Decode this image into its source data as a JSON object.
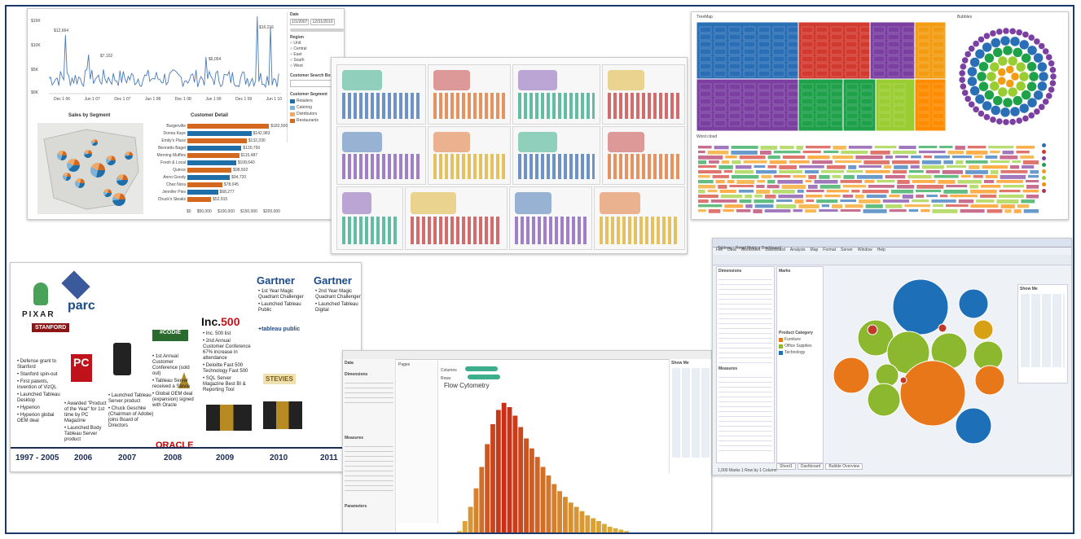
{
  "panel_sales": {
    "y_ticks": [
      "$15K",
      "$10K",
      "$5K",
      "$0K"
    ],
    "peak_labels": [
      "$12,664",
      "$7,152",
      "$6,054",
      "$16,216"
    ],
    "x_ticks": [
      "Dec 1 06",
      "Jun 1 07",
      "Dec 1 07",
      "Jun 1 08",
      "Dec 1 08",
      "Jun 1 09",
      "Dec 1 09",
      "Jun 1 10",
      "Dec 1 10"
    ],
    "filter": {
      "date_label": "Date",
      "date_from": "1/1/2007",
      "date_to": "12/31/2010",
      "region_label": "Region",
      "regions": [
        "Unit",
        "Central",
        "East",
        "South",
        "West"
      ],
      "search_label": "Customer Search Box",
      "segment_label": "Customer Segment",
      "segments": [
        "Retailers",
        "Catering",
        "Distributors",
        "Restaurants"
      ],
      "segment_colors": [
        "#1f6ea8",
        "#7fb2d8",
        "#f0a868",
        "#d2691e"
      ]
    },
    "map_title": "Sales by Segment",
    "detail_title": "Customer Detail",
    "customers": [
      "Burgerville",
      "Donna Kaye",
      "Emily's Place",
      "Bennetts Bagel",
      "Morning Muffins",
      "Fresh & Local",
      "Quince",
      "Anno Goody",
      "Chez Nora",
      "Jennifer Pies",
      "Chuck's Steaks"
    ],
    "customer_values": [
      "$182,500",
      "$142,983",
      "$132,330",
      "$120,750",
      "$115,487",
      "$108,640",
      "$98,502",
      "$94,720",
      "$78,045",
      "$68,277",
      "$52,915"
    ],
    "detail_axis": [
      "$0",
      "$50,000",
      "$100,000",
      "$150,000",
      "$200,000"
    ]
  },
  "timeline": {
    "logos": {
      "pixar": "PIXAR",
      "parc": "parc",
      "stanford": "STANFORD",
      "pc_mag": "PC",
      "oracle": "ORACLE",
      "inc": "Inc.",
      "inc_num": "500",
      "gartner1": "Gartner",
      "gartner2": "Gartner",
      "tableau_public": "+tableau public",
      "stevies": "STEVIES",
      "codie": "#CODiE"
    },
    "col_1997": [
      "Defense grant to Stanford",
      "Stanford spin-out",
      "First patents, invention of VizQL",
      "Launched Tableau Desktop",
      "Hyperion",
      "Hyperion global OEM deal"
    ],
    "col_2006": [
      "Awarded \"Product of the Year\" for 1st time by PC Magazine",
      "Launched Body Tableau Server product"
    ],
    "col_2007": [
      "Launched Tableau Server product",
      "Chuck Geschke (Chairman of Adobe) joins Board of Directors"
    ],
    "col_2008": [
      "1st Annual Customer Conference (sold out)",
      "Tableau Server received a Stevie",
      "Global OEM deal (expansion) signed with Oracle"
    ],
    "col_2009": [
      "Inc. 500 list",
      "2nd Annual Customer Conference 67% increase in attendance",
      "Deloitte Fast 500 Technology Fast 500",
      "SQL Server Magazine Best BI & Reporting Tool"
    ],
    "col_2010": [
      "1st Year Magic Quadrant Challenger",
      "Launched Tableau Public"
    ],
    "col_2011": [
      "2nd Year Magic Quadrant Challenger",
      "Launched Tableau Digital"
    ],
    "years": [
      "1997 - 2005",
      "2006",
      "2007",
      "2008",
      "2009",
      "2010",
      "2011"
    ]
  },
  "panel_treemap": {
    "treemap_title": "TreeMap",
    "bubble_title": "Bubbles",
    "word_title": "Word cloud",
    "colors": [
      "#2a6fb5",
      "#d23a2f",
      "#7a3fa0",
      "#1fa14a",
      "#f39c12",
      "#9acd32",
      "#ff8c00",
      "#b03060"
    ]
  },
  "panel_flow": {
    "title": "Flow Cytometry",
    "shelf_columns": "Columns",
    "shelf_rows": "Rows",
    "shelf_pages": "Pages",
    "side_data": "Data",
    "side_dimensions": "Dimensions",
    "side_measures": "Measures",
    "side_parameters": "Parameters",
    "show_me": "Show Me",
    "bar_heights": [
      0.05,
      0.12,
      0.22,
      0.35,
      0.5,
      0.66,
      0.8,
      0.9,
      0.95,
      0.92,
      0.86,
      0.78,
      0.7,
      0.63,
      0.57,
      0.5,
      0.44,
      0.38,
      0.33,
      0.29,
      0.25,
      0.22,
      0.19,
      0.16,
      0.14,
      0.12,
      0.1,
      0.08,
      0.07,
      0.06,
      0.05,
      0.04,
      0.035,
      0.03,
      0.025,
      0.02,
      0.015,
      0.01
    ]
  },
  "panel_bubble": {
    "window_title": "Tableau - Retail Metrics Dashboard",
    "menu": [
      "File",
      "Data",
      "Worksheet",
      "Dashboard",
      "Analysis",
      "Map",
      "Format",
      "Server",
      "Window",
      "Help"
    ],
    "dimensions_label": "Dimensions",
    "measures_label": "Measures",
    "marks_label": "Marks",
    "show_me": "Show Me",
    "legend_title": "Product Category",
    "legend_items": [
      "Furniture",
      "Office Supplies",
      "Technology"
    ],
    "tabs": [
      "Sheet1",
      "Dashboard",
      "Bubble Overview"
    ],
    "status": "1,000 Marks   1 Row by 1 Column"
  }
}
